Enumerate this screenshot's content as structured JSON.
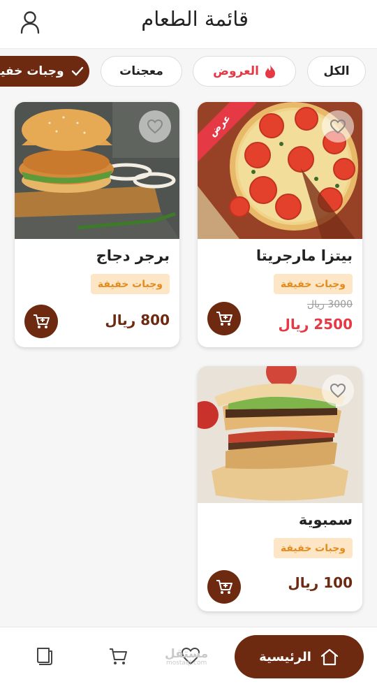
{
  "header": {
    "title": "قائمة الطعام",
    "user_icon": "user-icon"
  },
  "chips": {
    "all": "الكل",
    "offers": "العروض",
    "pastry": "معجنات",
    "light_meals": "وجبات خفيفة"
  },
  "products": [
    {
      "name": "بيتزا مارجريتا",
      "tag": "وجبات خفيفة",
      "old_price": "3000 ريال",
      "price": "2500 ريال",
      "badge": "عرض"
    },
    {
      "name": "برجر دجاج",
      "tag": "وجبات خفيفة",
      "price": "800 ريال"
    },
    {
      "name": "سمبوية",
      "tag": "وجبات خفيفة",
      "price": "100 ريال"
    }
  ],
  "nav": {
    "home": "الرئيسية"
  },
  "watermark": {
    "ar": "مستقل",
    "en": "mostaql.com"
  },
  "colors": {
    "primary": "#6d2a10",
    "sale": "#e53946",
    "tag_bg": "#fde6c6",
    "tag_text": "#e58a1c"
  }
}
